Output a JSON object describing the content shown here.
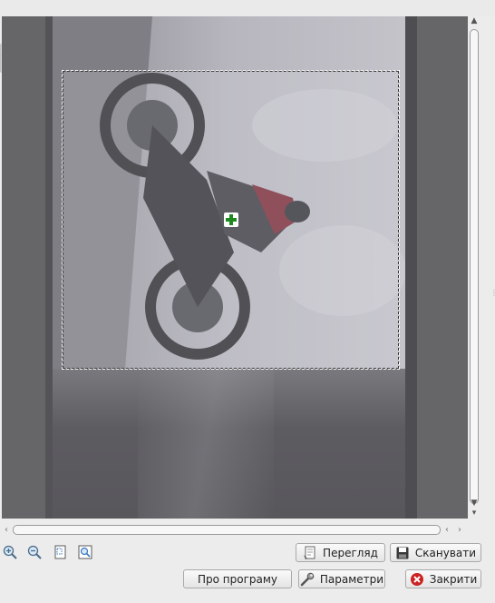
{
  "toolbar": {
    "zoom_in": "zoom-in-icon",
    "zoom_out": "zoom-out-icon",
    "zoom_fit": "zoom-fit-icon",
    "zoom_selection": "zoom-selection-icon"
  },
  "buttons": {
    "preview": "Перегляд",
    "scan": "Сканувати",
    "about": "Про програму",
    "settings": "Параметри",
    "close": "Закрити"
  },
  "colors": {
    "crosshair": "#1e8a1e",
    "close_icon": "#cc2222"
  },
  "preview_area": {
    "selection_tool": "dashed-selection-rectangle",
    "cursor": "green-plus-crosshair"
  }
}
